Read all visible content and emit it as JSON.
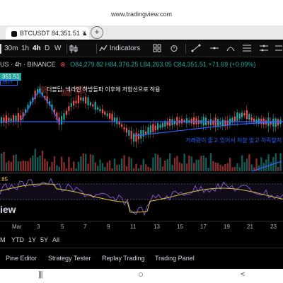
{
  "browser": {
    "url": "www.tradingview.com",
    "tab_title": "BTCUSDT 84,351.51 ▲ +...",
    "tab_close": "×",
    "new_tab": "+"
  },
  "toolbar": {
    "intervals": [
      "30m",
      "1h",
      "4h",
      "D",
      "W"
    ],
    "indicators_label": "Indicators"
  },
  "symbol": {
    "title": "US · 4h · BINANCE",
    "open": "O84,279.82",
    "high": "H84,376.25",
    "low": "L84,263.05",
    "close": "C84,351.51",
    "change": "+71.69 (+0.09%)",
    "price_tag": "351.51",
    "buy_label": "BUY"
  },
  "annotations": {
    "text_1": "더블탑, 넥라인 하방돌파 이후에 저항선으로 작용",
    "text_2": "거래량이 줄고 있어서 저항 맞고 하락할지"
  },
  "rsi": {
    "value": ".85"
  },
  "watermark": "iew",
  "dates": [
    "Mar",
    "3",
    "5",
    "7",
    "9",
    "11",
    "13",
    "15",
    "17",
    "19",
    "21",
    "23"
  ],
  "ranges": [
    "M",
    "YTD",
    "1Y",
    "5Y",
    "All"
  ],
  "panels": [
    "Pine Editor",
    "Strategy Tester",
    "Replay Trading",
    "Trading Panel"
  ],
  "navbar": [
    "|||",
    "○",
    "<"
  ],
  "colors": {
    "up": "#26a69a",
    "down": "#ef5350",
    "line": "#2962ff",
    "rsi": "#7e57c2",
    "rsi_ma": "#e2c04a"
  }
}
